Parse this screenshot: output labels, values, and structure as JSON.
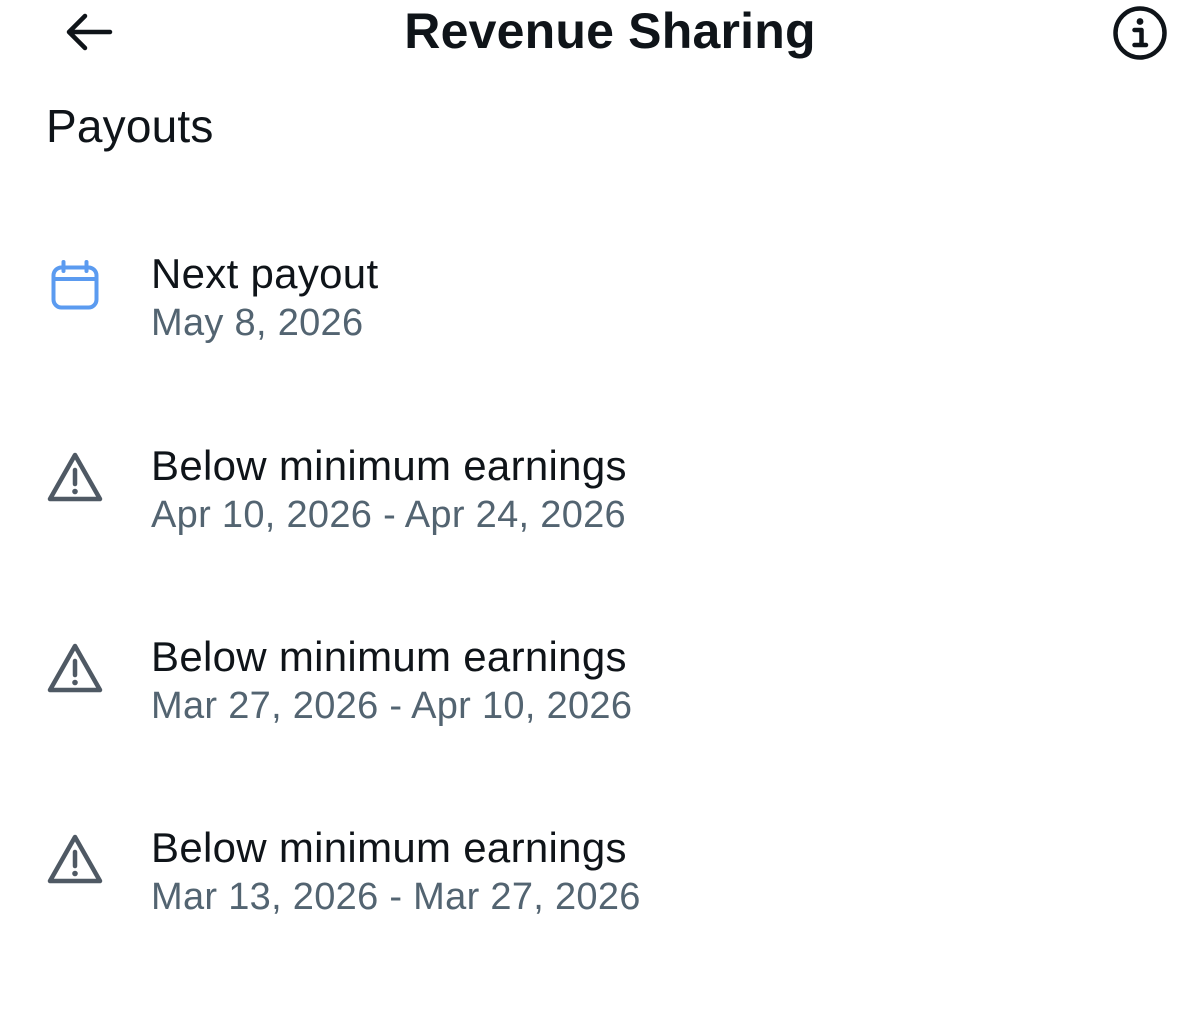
{
  "header": {
    "title": "Revenue Sharing",
    "back_icon": "arrow-left-icon",
    "info_icon": "info-circle-icon"
  },
  "section": {
    "title": "Payouts"
  },
  "colors": {
    "calendar_icon": "#5b9bf0",
    "warning_icon": "#4f5964",
    "secondary_text": "#536471",
    "primary_text": "#0f1419"
  },
  "items": [
    {
      "icon": "calendar-icon",
      "title": "Next payout",
      "subtitle": "May 8, 2026"
    },
    {
      "icon": "warning-icon",
      "title": "Below minimum earnings",
      "subtitle": "Apr 10, 2026 - Apr 24, 2026"
    },
    {
      "icon": "warning-icon",
      "title": "Below minimum earnings",
      "subtitle": "Mar 27, 2026 - Apr 10, 2026"
    },
    {
      "icon": "warning-icon",
      "title": "Below minimum earnings",
      "subtitle": "Mar 13, 2026 - Mar 27, 2026"
    }
  ]
}
